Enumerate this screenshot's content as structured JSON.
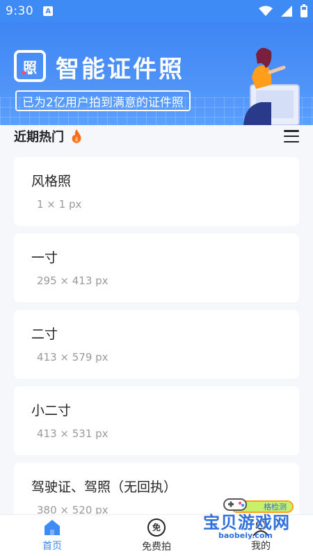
{
  "status_bar": {
    "time": "9:30",
    "notification_icon": "A"
  },
  "banner": {
    "logo_glyph": "照",
    "title": "智能证件照",
    "subtitle": "已为2亿用户拍到满意的证件照"
  },
  "section": {
    "title": "近期热门"
  },
  "cards": [
    {
      "title": "风格照",
      "size": "1 × 1 px"
    },
    {
      "title": "一寸",
      "size": "295 × 413 px"
    },
    {
      "title": "二寸",
      "size": "413 × 579 px"
    },
    {
      "title": "小二寸",
      "size": "413 × 531 px"
    },
    {
      "title": "驾驶证、驾照（无回执）",
      "size": "380 × 520 px"
    }
  ],
  "nav": [
    {
      "label": "首页"
    },
    {
      "label": "免费拍",
      "icon_text": "免"
    },
    {
      "label": "我的"
    }
  ],
  "watermark": {
    "text": "宝贝游戏网",
    "url": "baobeiy.com",
    "badge": "格检测"
  },
  "colors": {
    "primary": "#3e8bf6",
    "background": "#f6f7fb",
    "card": "#ffffff",
    "fire": "#ff6b1a"
  }
}
